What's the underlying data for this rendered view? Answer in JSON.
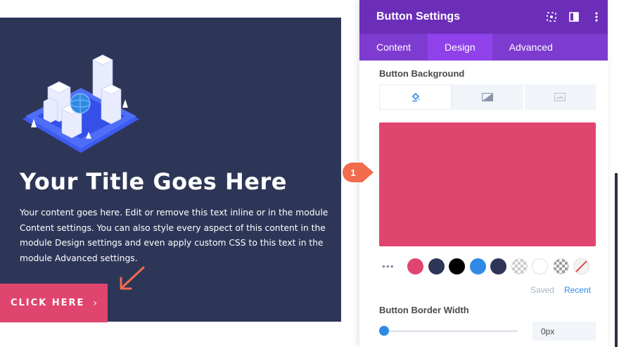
{
  "preview": {
    "title": "Your Title Goes Here",
    "body": "Your content goes here. Edit or remove this text inline or in the module Content settings. You can also style every aspect of this content in the module Design settings and even apply custom CSS to this text in the module Advanced settings.",
    "button_label": "CLICK HERE",
    "button_chevron": "›",
    "button_color": "#e0456f",
    "background_color": "#2e3658"
  },
  "panel": {
    "title": "Button Settings",
    "header_icons": [
      "target-icon",
      "sidebar-layout-icon",
      "more-vertical-icon"
    ],
    "tabs": [
      {
        "label": "Content",
        "active": false
      },
      {
        "label": "Design",
        "active": true
      },
      {
        "label": "Advanced",
        "active": false
      }
    ],
    "background_section": {
      "label": "Button Background",
      "type_tabs": [
        "paint-bucket-icon",
        "gradient-icon",
        "image-icon"
      ],
      "selected_color": "#e0456f"
    },
    "palette": {
      "more": "•••",
      "colors": [
        "#e0456f",
        "#2e3658",
        "#000000",
        "#2f8ae5",
        "#2e3658",
        "transparent",
        "#ffffff",
        "transparent-dark",
        "none"
      ],
      "saved_label": "Saved",
      "recent_label": "Recent"
    },
    "border_width": {
      "label": "Button Border Width",
      "value": "0px",
      "slider_fraction": 0.0
    }
  },
  "callout": {
    "number": "1",
    "color": "#f26b4b"
  },
  "colors": {
    "header_purple": "#6c2eb9",
    "tabs_purple": "#7e3bd0",
    "tab_active": "#8f42ea",
    "accent_blue": "#2f8ae5"
  }
}
